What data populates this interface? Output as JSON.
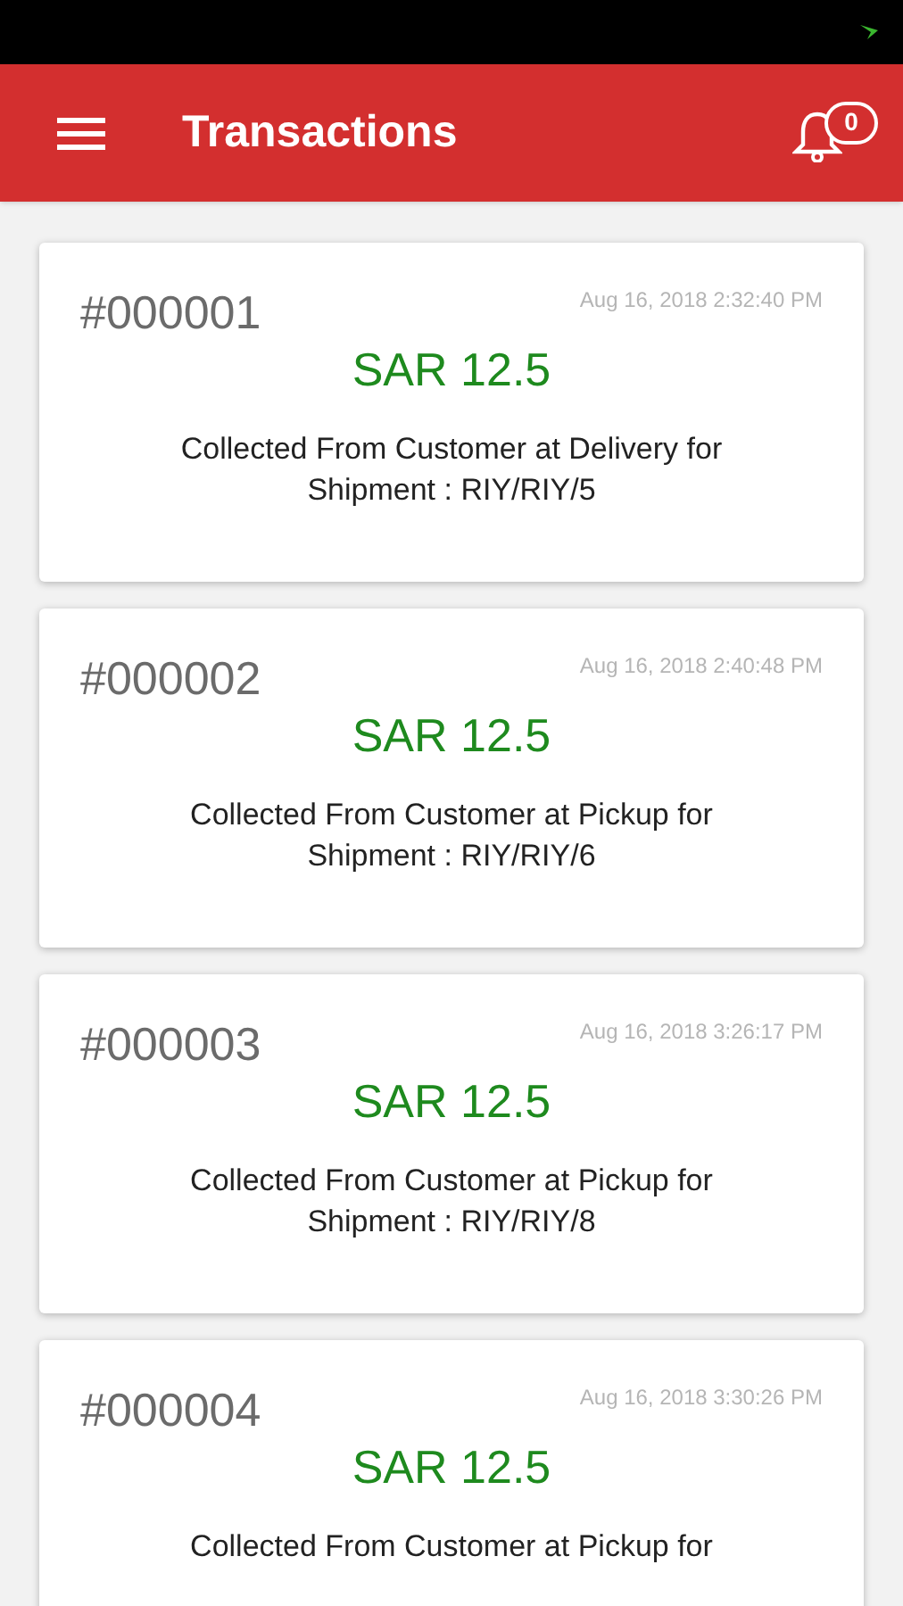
{
  "app_bar": {
    "title": "Transactions",
    "notification_count": "0"
  },
  "transactions": [
    {
      "number": "#000001",
      "timestamp": "Aug 16, 2018 2:32:40 PM",
      "amount": "SAR 12.5",
      "description": "Collected From Customer at Delivery for Shipment : RIY/RIY/5"
    },
    {
      "number": "#000002",
      "timestamp": "Aug 16, 2018 2:40:48 PM",
      "amount": "SAR 12.5",
      "description": "Collected From Customer at Pickup for Shipment : RIY/RIY/6"
    },
    {
      "number": "#000003",
      "timestamp": "Aug 16, 2018 3:26:17 PM",
      "amount": "SAR 12.5",
      "description": "Collected From Customer at Pickup for Shipment : RIY/RIY/8"
    },
    {
      "number": "#000004",
      "timestamp": "Aug 16, 2018 3:30:26 PM",
      "amount": "SAR 12.5",
      "description": "Collected From Customer at Pickup for"
    }
  ]
}
